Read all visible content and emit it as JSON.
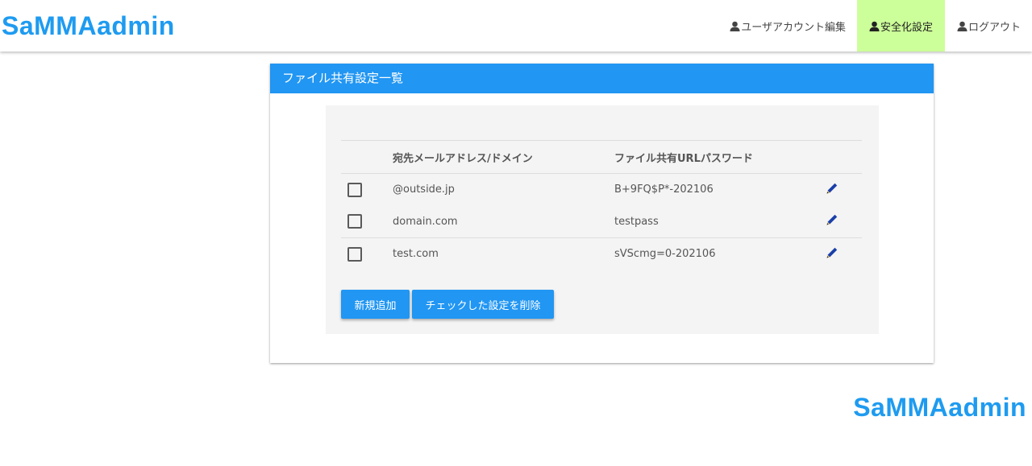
{
  "header": {
    "brand": "SaMMAadmin",
    "nav": [
      {
        "label": "ユーザアカウント編集",
        "icon": "user-icon",
        "active": false
      },
      {
        "label": "安全化設定",
        "icon": "user-icon",
        "active": true
      },
      {
        "label": "ログアウト",
        "icon": "user-icon",
        "active": false
      }
    ]
  },
  "panel": {
    "title": "ファイル共有設定一覧",
    "table": {
      "columns": [
        "",
        "宛先メールアドレス/ドメイン",
        "ファイル共有URLパスワード",
        ""
      ],
      "rows": [
        {
          "domain": "@outside.jp",
          "password": "B+9FQ$P*-202106",
          "checked": false
        },
        {
          "domain": "domain.com",
          "password": "testpass",
          "checked": false
        },
        {
          "domain": "test.com",
          "password": "sVScmg=0-202106",
          "checked": false
        }
      ]
    },
    "buttons": {
      "add": "新規追加",
      "delete": "チェックした設定を削除"
    }
  },
  "footer": {
    "brand": "SaMMAadmin"
  },
  "colors": {
    "brand": "#1e9bf0",
    "panel_header": "#2196f3",
    "active_nav": "#ccff99",
    "edit_icon": "#1a3fa8"
  }
}
